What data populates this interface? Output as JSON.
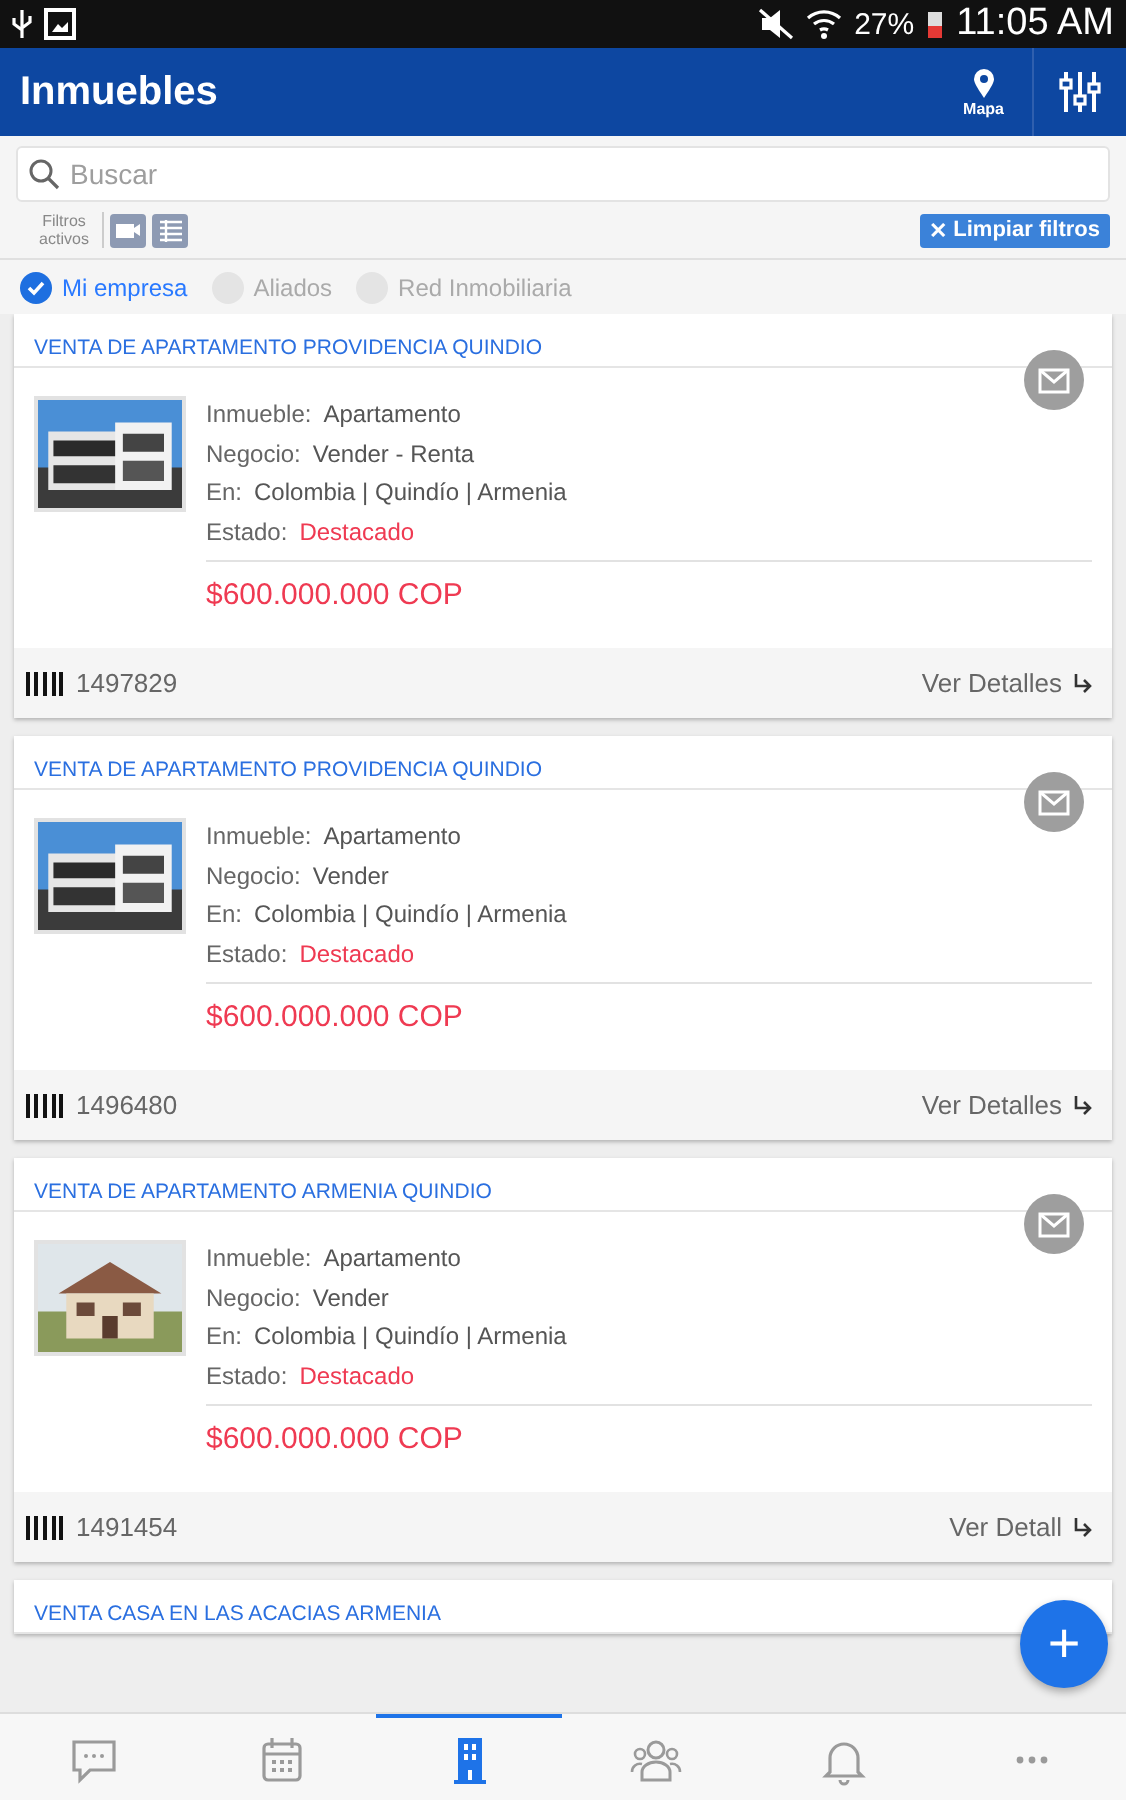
{
  "status_bar": {
    "battery": "27%",
    "time": "11:05 AM"
  },
  "app_bar": {
    "title": "Inmuebles",
    "map_label": "Mapa"
  },
  "search": {
    "placeholder": "Buscar"
  },
  "filters": {
    "label": "Filtros activos",
    "clear_label": "Limpiar filtros",
    "clear_icon": "✕"
  },
  "scopes": [
    {
      "label": "Mi empresa",
      "selected": true
    },
    {
      "label": "Aliados",
      "selected": false
    },
    {
      "label": "Red Inmobiliaria",
      "selected": false
    }
  ],
  "listings": [
    {
      "title": "VENTA DE APARTAMENTO PROVIDENCIA QUINDIO",
      "fields": [
        {
          "label": "Inmueble:",
          "value": "Apartamento",
          "kind": "plain"
        },
        {
          "label": "Negocio:",
          "value": "Vender - Renta",
          "kind": "plain"
        },
        {
          "label": "En:",
          "value": "Colombia | Quindío | Armenia",
          "kind": "plain"
        },
        {
          "label": "Estado:",
          "value": "Destacado",
          "kind": "status"
        }
      ],
      "price": "$600.000.000 COP",
      "code": "1497829",
      "details": "Ver Detalles"
    },
    {
      "title": "VENTA DE APARTAMENTO PROVIDENCIA QUINDIO",
      "fields": [
        {
          "label": "Inmueble:",
          "value": "Apartamento",
          "kind": "plain"
        },
        {
          "label": "Negocio:",
          "value": "Vender",
          "kind": "plain"
        },
        {
          "label": "En:",
          "value": "Colombia | Quindío | Armenia",
          "kind": "plain"
        },
        {
          "label": "Estado:",
          "value": "Destacado",
          "kind": "status"
        }
      ],
      "price": "$600.000.000 COP",
      "code": "1496480",
      "details": "Ver Detalles"
    },
    {
      "title": "VENTA DE APARTAMENTO ARMENIA QUINDIO",
      "fields": [
        {
          "label": "Inmueble:",
          "value": "Apartamento",
          "kind": "plain"
        },
        {
          "label": "Negocio:",
          "value": "Vender",
          "kind": "plain"
        },
        {
          "label": "En:",
          "value": "Colombia | Quindío | Armenia",
          "kind": "plain"
        },
        {
          "label": "Estado:",
          "value": "Destacado",
          "kind": "status"
        }
      ],
      "price": "$600.000.000 COP",
      "code": "1491454",
      "details": "Ver Detall"
    },
    {
      "title": "VENTA CASA EN LAS ACACIAS ARMENIA"
    }
  ],
  "fab": {
    "icon": "+"
  },
  "bottom_nav": [
    {
      "kind": "chat",
      "selected": false
    },
    {
      "kind": "calendar",
      "selected": false
    },
    {
      "kind": "building",
      "selected": true
    },
    {
      "kind": "people",
      "selected": false
    },
    {
      "kind": "bell",
      "selected": false
    },
    {
      "kind": "more",
      "selected": false
    }
  ]
}
